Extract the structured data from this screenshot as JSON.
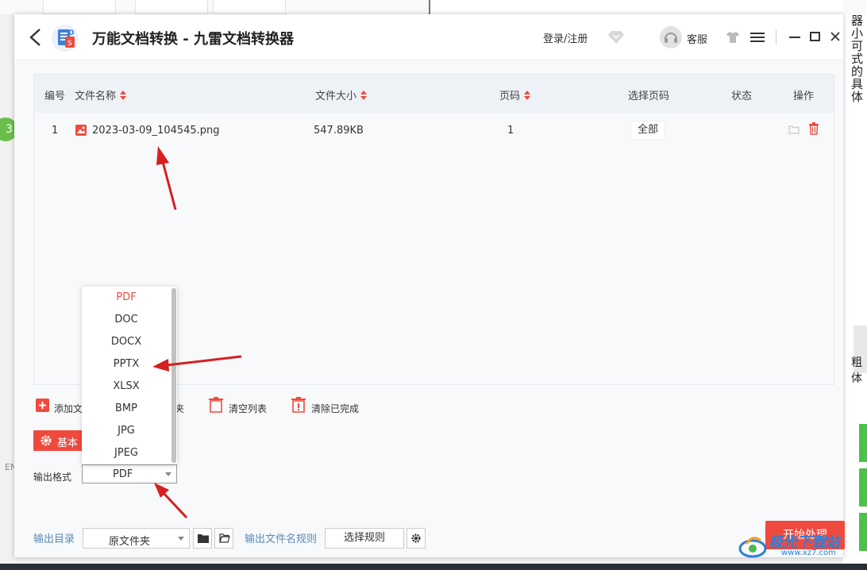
{
  "window": {
    "title": "万能文档转换 - 九雷文档转换器",
    "login_label": "登录/注册",
    "support_label": "客服"
  },
  "table": {
    "headers": {
      "index": "编号",
      "name": "文件名称",
      "size": "文件大小",
      "pages": "页码",
      "select_pages": "选择页码",
      "status": "状态",
      "actions": "操作"
    },
    "rows": [
      {
        "index": "1",
        "name": "2023-03-09_104545.png",
        "size": "547.89KB",
        "pages": "1",
        "select_pages": "全部",
        "status": ""
      }
    ]
  },
  "toolbar": {
    "add_file": "添加文",
    "add_folder_tail": "夹",
    "clear_list": "清空列表",
    "clear_done": "清除已完成"
  },
  "settings": {
    "basic_tab": "基本"
  },
  "format": {
    "label": "输出格式",
    "selected": "PDF",
    "options": [
      "PDF",
      "DOC",
      "DOCX",
      "PPTX",
      "XLSX",
      "BMP",
      "JPG",
      "JPEG"
    ]
  },
  "output": {
    "dir_label": "输出目录",
    "dir_value": "原文件夹",
    "rule_label": "输出文件名规则",
    "rule_button": "选择规则",
    "start_button": "开始处理"
  },
  "background": {
    "right_chars": [
      "器",
      "小",
      "可",
      "式的",
      "具体"
    ],
    "right_mid": "粗体",
    "left_badge": "3",
    "left_en": "EN"
  },
  "watermark": {
    "main": "极光下载站",
    "sub": "www.xz7.com"
  },
  "colors": {
    "accent": "#f04a3e",
    "link": "#5a8ab8",
    "arrow": "#d62020"
  }
}
